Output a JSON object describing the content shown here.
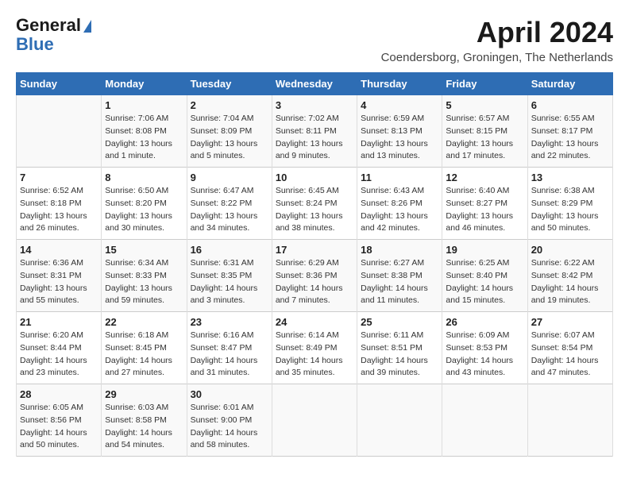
{
  "header": {
    "logo_general": "General",
    "logo_blue": "Blue",
    "month_title": "April 2024",
    "location": "Coendersborg, Groningen, The Netherlands"
  },
  "days_of_week": [
    "Sunday",
    "Monday",
    "Tuesday",
    "Wednesday",
    "Thursday",
    "Friday",
    "Saturday"
  ],
  "weeks": [
    [
      {
        "day": "",
        "sunrise": "",
        "sunset": "",
        "daylight": ""
      },
      {
        "day": "1",
        "sunrise": "Sunrise: 7:06 AM",
        "sunset": "Sunset: 8:08 PM",
        "daylight": "Daylight: 13 hours and 1 minute."
      },
      {
        "day": "2",
        "sunrise": "Sunrise: 7:04 AM",
        "sunset": "Sunset: 8:09 PM",
        "daylight": "Daylight: 13 hours and 5 minutes."
      },
      {
        "day": "3",
        "sunrise": "Sunrise: 7:02 AM",
        "sunset": "Sunset: 8:11 PM",
        "daylight": "Daylight: 13 hours and 9 minutes."
      },
      {
        "day": "4",
        "sunrise": "Sunrise: 6:59 AM",
        "sunset": "Sunset: 8:13 PM",
        "daylight": "Daylight: 13 hours and 13 minutes."
      },
      {
        "day": "5",
        "sunrise": "Sunrise: 6:57 AM",
        "sunset": "Sunset: 8:15 PM",
        "daylight": "Daylight: 13 hours and 17 minutes."
      },
      {
        "day": "6",
        "sunrise": "Sunrise: 6:55 AM",
        "sunset": "Sunset: 8:17 PM",
        "daylight": "Daylight: 13 hours and 22 minutes."
      }
    ],
    [
      {
        "day": "7",
        "sunrise": "Sunrise: 6:52 AM",
        "sunset": "Sunset: 8:18 PM",
        "daylight": "Daylight: 13 hours and 26 minutes."
      },
      {
        "day": "8",
        "sunrise": "Sunrise: 6:50 AM",
        "sunset": "Sunset: 8:20 PM",
        "daylight": "Daylight: 13 hours and 30 minutes."
      },
      {
        "day": "9",
        "sunrise": "Sunrise: 6:47 AM",
        "sunset": "Sunset: 8:22 PM",
        "daylight": "Daylight: 13 hours and 34 minutes."
      },
      {
        "day": "10",
        "sunrise": "Sunrise: 6:45 AM",
        "sunset": "Sunset: 8:24 PM",
        "daylight": "Daylight: 13 hours and 38 minutes."
      },
      {
        "day": "11",
        "sunrise": "Sunrise: 6:43 AM",
        "sunset": "Sunset: 8:26 PM",
        "daylight": "Daylight: 13 hours and 42 minutes."
      },
      {
        "day": "12",
        "sunrise": "Sunrise: 6:40 AM",
        "sunset": "Sunset: 8:27 PM",
        "daylight": "Daylight: 13 hours and 46 minutes."
      },
      {
        "day": "13",
        "sunrise": "Sunrise: 6:38 AM",
        "sunset": "Sunset: 8:29 PM",
        "daylight": "Daylight: 13 hours and 50 minutes."
      }
    ],
    [
      {
        "day": "14",
        "sunrise": "Sunrise: 6:36 AM",
        "sunset": "Sunset: 8:31 PM",
        "daylight": "Daylight: 13 hours and 55 minutes."
      },
      {
        "day": "15",
        "sunrise": "Sunrise: 6:34 AM",
        "sunset": "Sunset: 8:33 PM",
        "daylight": "Daylight: 13 hours and 59 minutes."
      },
      {
        "day": "16",
        "sunrise": "Sunrise: 6:31 AM",
        "sunset": "Sunset: 8:35 PM",
        "daylight": "Daylight: 14 hours and 3 minutes."
      },
      {
        "day": "17",
        "sunrise": "Sunrise: 6:29 AM",
        "sunset": "Sunset: 8:36 PM",
        "daylight": "Daylight: 14 hours and 7 minutes."
      },
      {
        "day": "18",
        "sunrise": "Sunrise: 6:27 AM",
        "sunset": "Sunset: 8:38 PM",
        "daylight": "Daylight: 14 hours and 11 minutes."
      },
      {
        "day": "19",
        "sunrise": "Sunrise: 6:25 AM",
        "sunset": "Sunset: 8:40 PM",
        "daylight": "Daylight: 14 hours and 15 minutes."
      },
      {
        "day": "20",
        "sunrise": "Sunrise: 6:22 AM",
        "sunset": "Sunset: 8:42 PM",
        "daylight": "Daylight: 14 hours and 19 minutes."
      }
    ],
    [
      {
        "day": "21",
        "sunrise": "Sunrise: 6:20 AM",
        "sunset": "Sunset: 8:44 PM",
        "daylight": "Daylight: 14 hours and 23 minutes."
      },
      {
        "day": "22",
        "sunrise": "Sunrise: 6:18 AM",
        "sunset": "Sunset: 8:45 PM",
        "daylight": "Daylight: 14 hours and 27 minutes."
      },
      {
        "day": "23",
        "sunrise": "Sunrise: 6:16 AM",
        "sunset": "Sunset: 8:47 PM",
        "daylight": "Daylight: 14 hours and 31 minutes."
      },
      {
        "day": "24",
        "sunrise": "Sunrise: 6:14 AM",
        "sunset": "Sunset: 8:49 PM",
        "daylight": "Daylight: 14 hours and 35 minutes."
      },
      {
        "day": "25",
        "sunrise": "Sunrise: 6:11 AM",
        "sunset": "Sunset: 8:51 PM",
        "daylight": "Daylight: 14 hours and 39 minutes."
      },
      {
        "day": "26",
        "sunrise": "Sunrise: 6:09 AM",
        "sunset": "Sunset: 8:53 PM",
        "daylight": "Daylight: 14 hours and 43 minutes."
      },
      {
        "day": "27",
        "sunrise": "Sunrise: 6:07 AM",
        "sunset": "Sunset: 8:54 PM",
        "daylight": "Daylight: 14 hours and 47 minutes."
      }
    ],
    [
      {
        "day": "28",
        "sunrise": "Sunrise: 6:05 AM",
        "sunset": "Sunset: 8:56 PM",
        "daylight": "Daylight: 14 hours and 50 minutes."
      },
      {
        "day": "29",
        "sunrise": "Sunrise: 6:03 AM",
        "sunset": "Sunset: 8:58 PM",
        "daylight": "Daylight: 14 hours and 54 minutes."
      },
      {
        "day": "30",
        "sunrise": "Sunrise: 6:01 AM",
        "sunset": "Sunset: 9:00 PM",
        "daylight": "Daylight: 14 hours and 58 minutes."
      },
      {
        "day": "",
        "sunrise": "",
        "sunset": "",
        "daylight": ""
      },
      {
        "day": "",
        "sunrise": "",
        "sunset": "",
        "daylight": ""
      },
      {
        "day": "",
        "sunrise": "",
        "sunset": "",
        "daylight": ""
      },
      {
        "day": "",
        "sunrise": "",
        "sunset": "",
        "daylight": ""
      }
    ]
  ]
}
